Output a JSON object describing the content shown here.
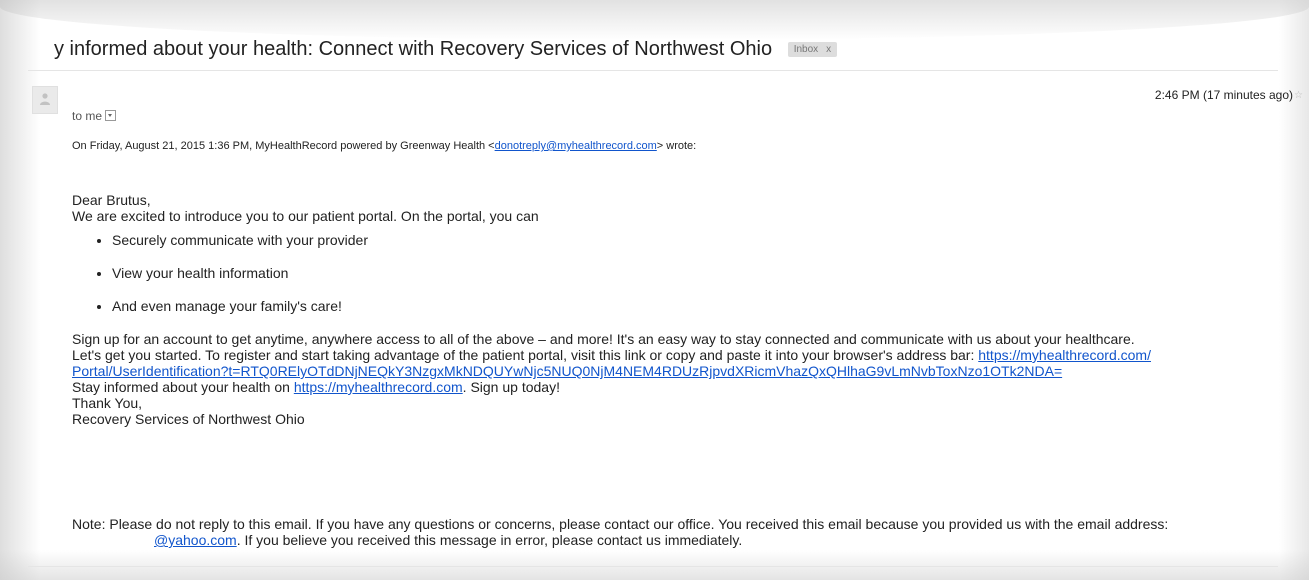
{
  "email": {
    "subject": "y informed about your health: Connect with Recovery Services of Northwest Ohio",
    "label": "Inbox",
    "label_close": "x",
    "time": "2:46 PM (17 minutes ago)",
    "to": "to me",
    "quoted_header_pre": "On Friday, August 21, 2015 1:36 PM, MyHealthRecord powered by Greenway Health <",
    "sender_email": "donotreply@myhealthrecord.com",
    "quoted_header_post": "> wrote:"
  },
  "body": {
    "greeting": "Dear Brutus,",
    "intro": "We are excited to introduce you to our patient portal. On the portal, you can",
    "bullets": [
      "Securely communicate with your provider",
      "View your health information",
      "And even manage your family's care!"
    ],
    "signup": "Sign up for an account to get anytime, anywhere access to all of the above – and more! It's an easy way to stay connected and communicate with us about your healthcare.",
    "register_pre": "Let's get you started. To register and start taking advantage of the patient portal, visit this link or copy and paste it into your browser's address bar: ",
    "register_link_1": "https://myhealthrecord.com/",
    "register_link_2": "Portal/UserIdentification?t=RTQ0RElyOTdDNjNEQkY3NzgxMkNDQUYwNjc5NUQ0NjM4NEM4RDUzRjpvdXRicmVhazQxQHlhaG9vLmNvbToxNzo1OTk2NDA=",
    "stay_pre": "Stay informed about your health on ",
    "stay_link": "https://myhealthrecord.com",
    "stay_post": ". Sign up today!",
    "thanks": "Thank You,",
    "signature": "Recovery Services of Northwest Ohio"
  },
  "note": {
    "text": "Note: Please do not reply to this email. If you have any questions or concerns, please contact our office. You received this email because you provided us with the email address:",
    "email_link": "@yahoo.com",
    "text_post": ". If you believe you received this message in error, please contact us immediately."
  },
  "icons": {
    "avatar": "person-icon",
    "dropdown": "chevron-down-icon"
  }
}
